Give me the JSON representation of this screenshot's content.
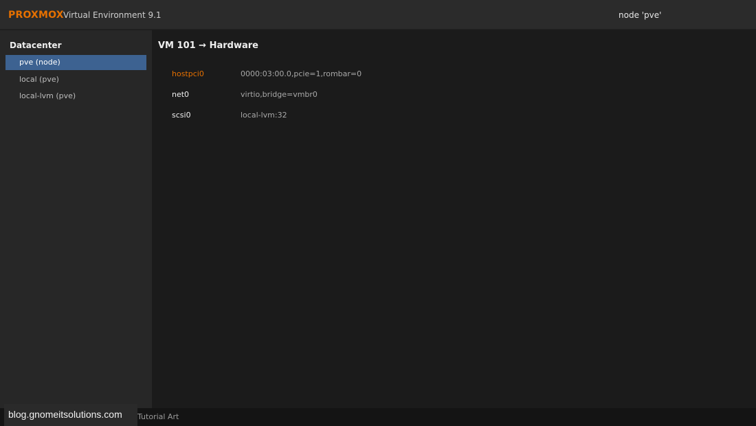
{
  "header": {
    "brand": "PROXMOX",
    "version": "Virtual Environment 9.1",
    "node_indicator": "node 'pve'"
  },
  "sidebar": {
    "root_label": "Datacenter",
    "items": [
      {
        "label": "pve (node)",
        "selected": true
      },
      {
        "label": "local (pve)",
        "selected": false
      },
      {
        "label": "local-lvm (pve)",
        "selected": false
      }
    ]
  },
  "main": {
    "title": "VM 101 → Hardware",
    "hardware": [
      {
        "key": "hostpci0",
        "value": "0000:03:00.0,pcie=1,rombar=0",
        "highlight": true
      },
      {
        "key": "net0",
        "value": "virtio,bridge=vmbr0",
        "highlight": false
      },
      {
        "key": "scsi0",
        "value": "local-lvm:32",
        "highlight": false
      }
    ]
  },
  "footer": {
    "text": "Tutorial Art"
  },
  "watermark": {
    "text": "blog.gnomeitsolutions.com"
  },
  "colors": {
    "accent": "#e57000",
    "selection": "#3d6291",
    "background": "#1b1b1b",
    "header_bg": "#2b2b2b",
    "sidebar_bg": "#272727"
  }
}
